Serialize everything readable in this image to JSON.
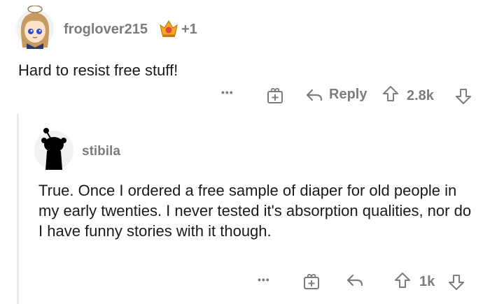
{
  "comment": {
    "username": "froglover215",
    "award_count": "+1",
    "text": "Hard to resist free stuff!",
    "actions": {
      "more": "•••",
      "reply_label": "Reply",
      "score": "2.8k"
    }
  },
  "reply": {
    "username": "stibila",
    "text": "True. Once I ordered a free sample of diaper for old people in my early twenties. I never tested it's absorption qualities, nor do I have funny stories with it though.",
    "actions": {
      "more": "•••",
      "score": "1k"
    }
  },
  "colors": {
    "meta_grey": "#7c7c7c",
    "body_text": "#1a1a1b",
    "award_gold": "#f5a623",
    "award_red": "#e0443a",
    "thread_line": "#ebebeb"
  },
  "icons": [
    "avatar-frog-girl",
    "award-icon",
    "more-icon",
    "gift-icon",
    "reply-arrow-icon",
    "upvote-icon",
    "downvote-icon",
    "snoo-avatar"
  ]
}
